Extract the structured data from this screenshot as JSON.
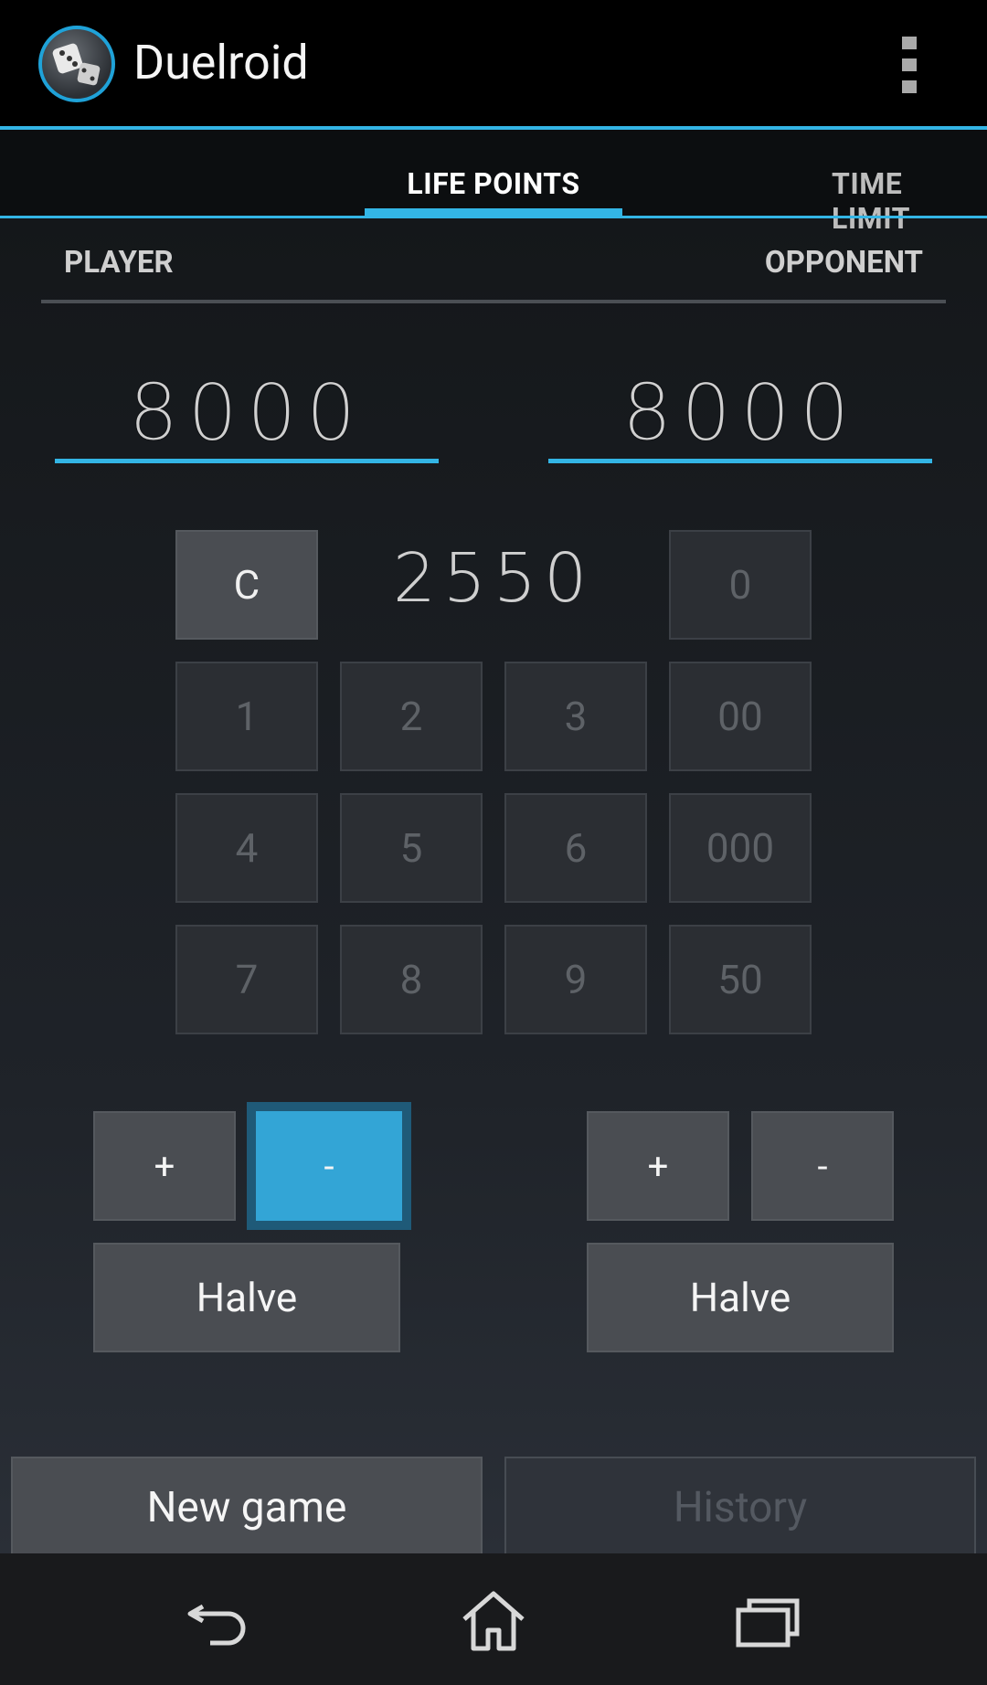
{
  "app": {
    "title": "Duelroid"
  },
  "tabs": [
    {
      "label": "LIFE POINTS"
    },
    {
      "label": "TIME LIMIT"
    }
  ],
  "header": {
    "player": "PLAYER",
    "opponent": "OPPONENT"
  },
  "life_points": {
    "player": "8000",
    "opponent": "8000"
  },
  "keypad": {
    "clear": "C",
    "entry": "2550",
    "keys": [
      "0",
      "1",
      "2",
      "3",
      "00",
      "4",
      "5",
      "6",
      "000",
      "7",
      "8",
      "9",
      "50"
    ]
  },
  "controls": {
    "player": {
      "plus": "+",
      "minus": "-",
      "halve": "Halve"
    },
    "opponent": {
      "plus": "+",
      "minus": "-",
      "halve": "Halve"
    }
  },
  "footer": {
    "new_game": "New game",
    "history": "History"
  },
  "icons": {
    "app": "dice-icon",
    "overflow": "overflow-menu-icon",
    "back": "back-icon",
    "home": "home-icon",
    "recents": "recent-apps-icon"
  },
  "colors": {
    "accent": "#33b5e5",
    "active_button": "#33a5d6"
  }
}
